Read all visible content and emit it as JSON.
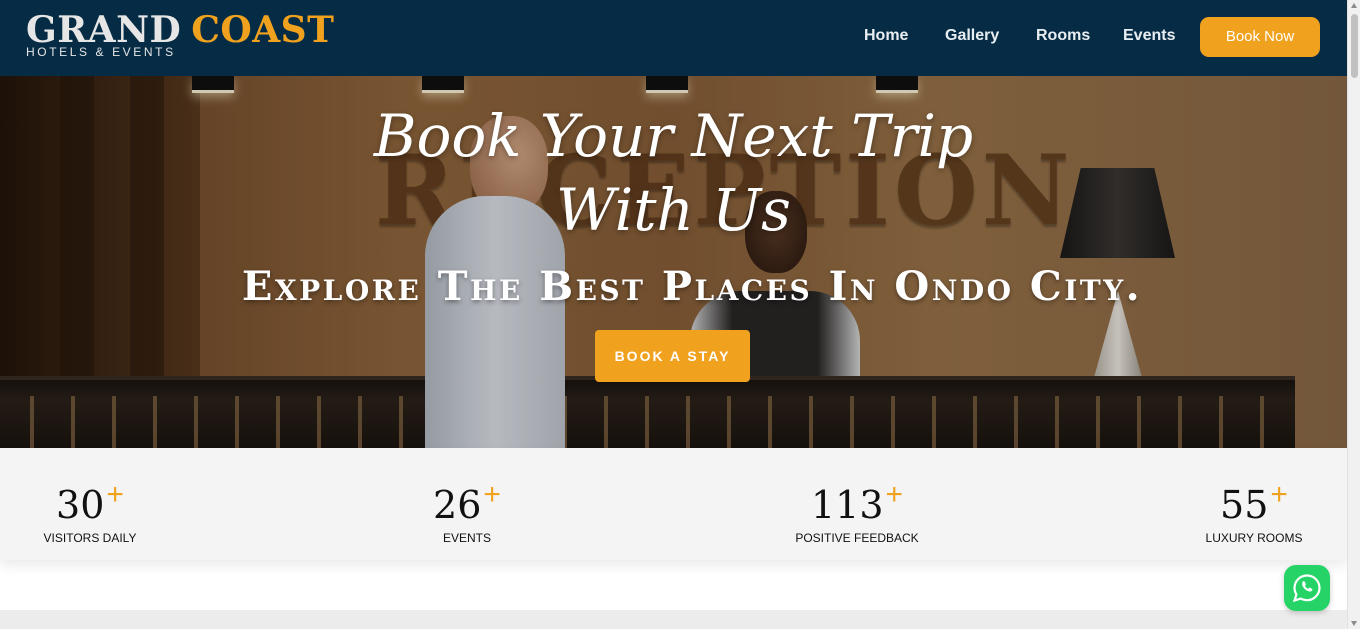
{
  "brand": {
    "name_part1": "GRAND",
    "name_part2": "COAST",
    "tagline": "HOTELS & EVENTS"
  },
  "nav": {
    "items": [
      "Home",
      "Gallery",
      "Rooms",
      "Events"
    ],
    "cta": "Book Now"
  },
  "hero": {
    "title_line1": "Book Your Next Trip",
    "title_line2": "With Us",
    "subtitle": "Explore The Best Places In Ondo City.",
    "cta": "BOOK A STAY",
    "background_sign": "RECEPTION"
  },
  "stats": [
    {
      "value": "30",
      "suffix": "+",
      "label": "VISITORS DAILY"
    },
    {
      "value": "26",
      "suffix": "+",
      "label": "EVENTS"
    },
    {
      "value": "113",
      "suffix": "+",
      "label": "POSITIVE FEEDBACK"
    },
    {
      "value": "55",
      "suffix": "+",
      "label": "LUXURY ROOMS"
    }
  ],
  "floating": {
    "icon": "whatsapp-icon"
  },
  "colors": {
    "header_bg": "#062c45",
    "accent": "#f0a21e",
    "whatsapp": "#25d366"
  }
}
